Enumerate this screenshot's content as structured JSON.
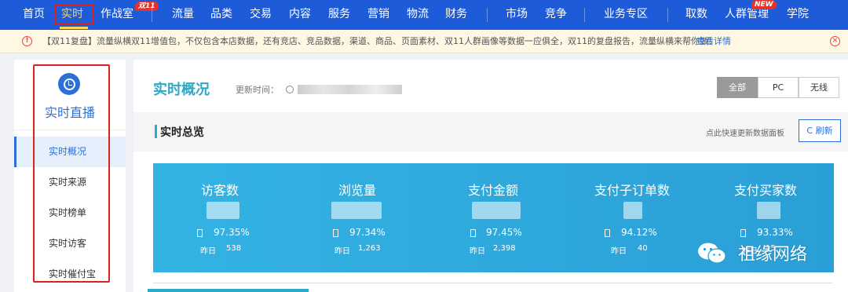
{
  "topnav": {
    "items": [
      {
        "label": "首页"
      },
      {
        "label": "实时"
      },
      {
        "label": "作战室"
      },
      {
        "label": "流量"
      },
      {
        "label": "品类"
      },
      {
        "label": "交易"
      },
      {
        "label": "内容"
      },
      {
        "label": "服务"
      },
      {
        "label": "营销"
      },
      {
        "label": "物流"
      },
      {
        "label": "财务"
      },
      {
        "label": "市场"
      },
      {
        "label": "竞争"
      },
      {
        "label": "业务专区"
      },
      {
        "label": "取数"
      },
      {
        "label": "人群管理"
      },
      {
        "label": "学院"
      }
    ],
    "badge_double11": "双11",
    "badge_new": "NEW",
    "active_color": "#ffd54a",
    "bg_color": "#1e5bd8"
  },
  "notice": {
    "text": "【双11复盘】流量纵横双11增值包，不仅包含本店数据，还有竞店、竞品数据，渠道、商品、页面素材、双11人群画像等数据一应俱全，双11的复盘报告，流量纵横来帮你做！",
    "link": "查看详情"
  },
  "sidebar": {
    "title": "实时直播",
    "items": [
      {
        "label": "实时概况"
      },
      {
        "label": "实时来源"
      },
      {
        "label": "实时榜单"
      },
      {
        "label": "实时访客"
      },
      {
        "label": "实时催付宝"
      }
    ]
  },
  "main": {
    "title": "实时概况",
    "update_label": "更新时间：",
    "segments": [
      "全部",
      "PC",
      "无线"
    ],
    "section_title": "实时总览",
    "hint": "点此快速更新数据面板",
    "refresh": "C 刷新"
  },
  "metrics": [
    {
      "title": "访客数",
      "pct": "97.35%",
      "yesterday_label": "昨日",
      "yesterday_value": "538"
    },
    {
      "title": "浏览量",
      "pct": "97.34%",
      "yesterday_label": "昨日",
      "yesterday_value": "1,263"
    },
    {
      "title": "支付金额",
      "pct": "97.45%",
      "yesterday_label": "昨日",
      "yesterday_value": "2,398"
    },
    {
      "title": "支付子订单数",
      "pct": "94.12%",
      "yesterday_label": "昨日",
      "yesterday_value": "40"
    },
    {
      "title": "支付买家数",
      "pct": "93.33%",
      "yesterday_label": "昨日",
      "yesterday_value": "15"
    }
  ],
  "watermark": "祖缘网络"
}
